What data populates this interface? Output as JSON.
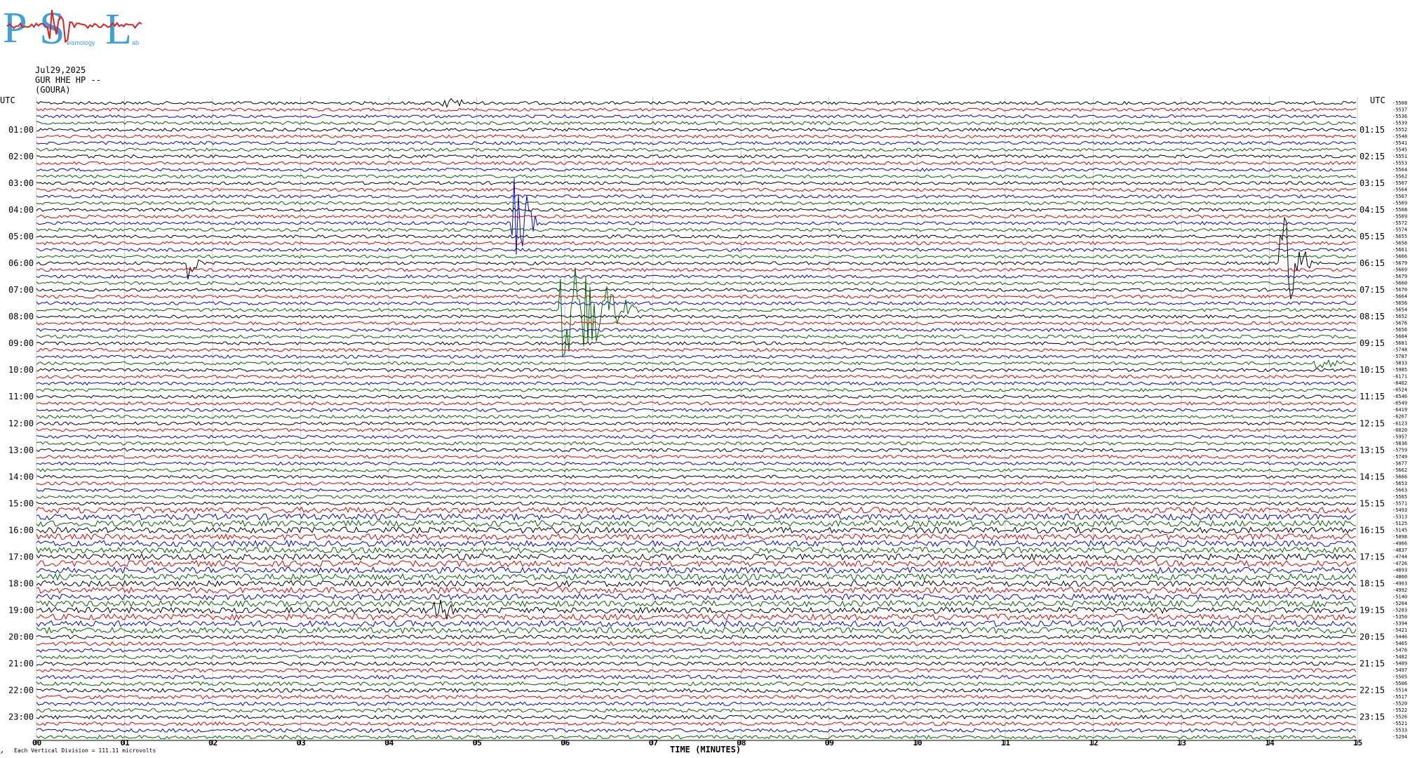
{
  "logo": {
    "text_p": "P",
    "text_s": "S",
    "text_l": "L",
    "text_small_1": "eismology",
    "text_small_2": "ab",
    "color_blue": "#3aa0e0",
    "color_red": "#e02020"
  },
  "header": {
    "date": "Jul29,2025",
    "station": "GUR HHE HP --",
    "location": "(GOURA)"
  },
  "axes": {
    "left_label": "UTC",
    "right_label": "UTC",
    "left_hours": [
      "01:00",
      "02:00",
      "03:00",
      "04:00",
      "05:00",
      "06:00",
      "07:00",
      "08:00",
      "09:00",
      "10:00",
      "11:00",
      "12:00",
      "13:00",
      "14:00",
      "15:00",
      "16:00",
      "17:00",
      "18:00",
      "19:00",
      "20:00",
      "21:00",
      "22:00",
      "23:00"
    ],
    "right_hours": [
      "01:15",
      "02:15",
      "03:15",
      "04:15",
      "05:15",
      "06:15",
      "07:15",
      "08:15",
      "09:15",
      "10:15",
      "11:15",
      "12:15",
      "13:15",
      "14:15",
      "15:15",
      "16:15",
      "17:15",
      "18:15",
      "19:15",
      "20:15",
      "21:15",
      "22:15",
      "23:15"
    ],
    "x_ticks": [
      "00",
      "01",
      "02",
      "03",
      "04",
      "05",
      "06",
      "07",
      "08",
      "09",
      "10",
      "11",
      "12",
      "13",
      "14",
      "15"
    ],
    "x_label": "TIME (MINUTES)",
    "scale_note": "Each Vertical Division = 111.11 microvolts",
    "footer_mark": "↗"
  },
  "chart_data": {
    "type": "line",
    "title": "",
    "xlabel": "TIME (MINUTES)",
    "ylabel": "UTC",
    "xlim": [
      0,
      15
    ],
    "rows": 96,
    "row_minutes": 15,
    "trace_colors": [
      "#000000",
      "#e00000",
      "#0000e0",
      "#006400"
    ],
    "grid": true,
    "right_values": [
      "-5508",
      "-5537",
      "-5536",
      "-5539",
      "-5552",
      "-5548",
      "-5541",
      "-5545",
      "-5551",
      "-5553",
      "-5564",
      "-5562",
      "-5567",
      "-5564",
      "-5567",
      "-5569",
      "-5568",
      "-5569",
      "-5572",
      "-5574",
      "-5655",
      "-5658",
      "-5661",
      "-5666",
      "-5679",
      "-5669",
      "-5679",
      "-5660",
      "-5670",
      "-5664",
      "-5656",
      "-5654",
      "-5652",
      "-5676",
      "-5656",
      "-5684",
      "-5681",
      "-5748",
      "-5787",
      "-5833",
      "-5985",
      "-6171",
      "-6402",
      "-6524",
      "-6546",
      "-6549",
      "-6419",
      "-6267",
      "-6123",
      "-6020",
      "-5957",
      "-5836",
      "-5759",
      "-5749",
      "-5677",
      "-5662",
      "-5666",
      "-5653",
      "-5663",
      "-5565",
      "-5571",
      "-5493",
      "-5313",
      "-5125",
      "-5145",
      "-5098",
      "-4966",
      "-4837",
      "-4744",
      "-4726",
      "-4893",
      "-4860",
      "-4903",
      "-4992",
      "-5140",
      "-5204",
      "-5283",
      "-5350",
      "-5394",
      "-5421",
      "-5446",
      "-5465",
      "-5476",
      "-5482",
      "-5489",
      "-5497",
      "-5505",
      "-5506",
      "-5514",
      "-5517",
      "-5520",
      "-5522",
      "-5526",
      "-5521",
      "-5533",
      "-5294"
    ],
    "events": [
      {
        "row": 0,
        "minute": 4.6,
        "amp": 8,
        "dur": 0.4
      },
      {
        "row": 18,
        "minute": 5.4,
        "amp": 80,
        "dur": 0.3
      },
      {
        "row": 18,
        "minute": 5.5,
        "amp": 30,
        "dur": 0.3
      },
      {
        "row": 24,
        "minute": 1.7,
        "amp": 30,
        "dur": 0.2
      },
      {
        "row": 31,
        "minute": 5.95,
        "amp": 90,
        "dur": 0.9
      },
      {
        "row": 24,
        "minute": 14.1,
        "amp": 90,
        "dur": 0.4
      },
      {
        "row": 39,
        "minute": 14.5,
        "amp": 10,
        "dur": 0.4
      },
      {
        "row": 76,
        "minute": 4.5,
        "amp": 20,
        "dur": 0.3
      }
    ]
  }
}
